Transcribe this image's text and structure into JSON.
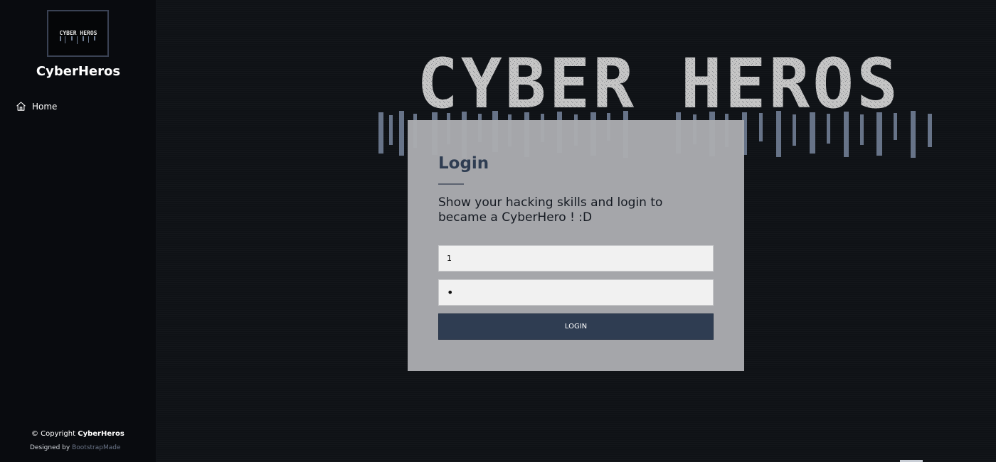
{
  "sidebar": {
    "logo_text": "CYBER HEROS",
    "brand": "CyberHeros",
    "nav": [
      {
        "label": "Home",
        "icon": "house-icon"
      }
    ],
    "footer": {
      "copyright_prefix": "© Copyright",
      "copyright_brand": "CyberHeros",
      "designed_by_prefix": "Designed by",
      "designed_by_link": "BootstrapMade"
    }
  },
  "hero": {
    "text": "CYBER HEROS",
    "colors": {
      "letters": "#c9c9c9",
      "drip": "#6f7c92"
    }
  },
  "login": {
    "title": "Login",
    "description": "Show your hacking skills and login to became a CyberHero ! :D",
    "username_value": "1",
    "password_value": "•",
    "button_label": "LOGIN"
  },
  "colors": {
    "background": "#0f1216",
    "sidebar": "#090b0f",
    "card": "#aaabaf",
    "accent": "#2f3d52"
  }
}
